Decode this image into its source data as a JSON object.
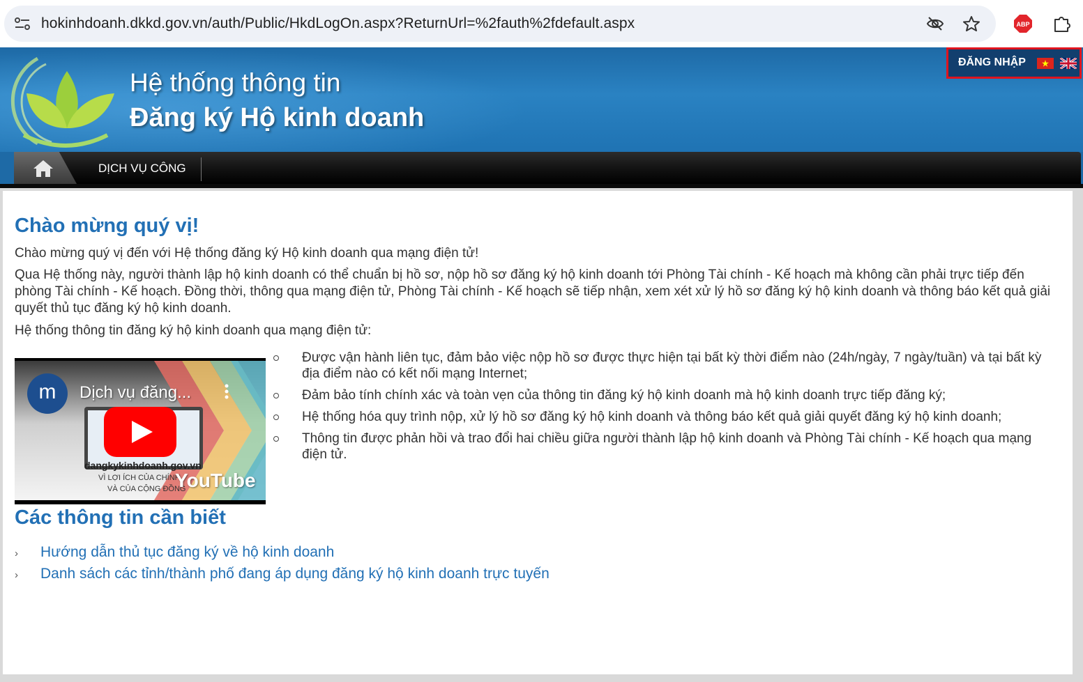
{
  "browser": {
    "url": "hokinhdoanh.dkkd.gov.vn/auth/Public/HkdLogOn.aspx?ReturnUrl=%2fauth%2fdefault.aspx",
    "abp_label": "ABP"
  },
  "header": {
    "title_line1": "Hệ thống thông tin",
    "title_line2": "Đăng ký Hộ kinh doanh",
    "login_label": "ĐĂNG NHẬP"
  },
  "nav": {
    "items": [
      {
        "label": "DỊCH VỤ CÔNG"
      }
    ]
  },
  "main": {
    "welcome_heading": "Chào mừng quý vị!",
    "intro": "Chào mừng quý vị đến với Hệ thống đăng ký Hộ kinh doanh qua mạng điện tử!",
    "description": "Qua Hệ thống này, người thành lập hộ kinh doanh có thể chuẩn bị hồ sơ, nộp hồ sơ đăng ký hộ kinh doanh tới Phòng Tài chính - Kế hoạch mà không cần phải trực tiếp đến phòng Tài chính - Kế hoạch. Đồng thời, thông qua mạng điện tử, Phòng Tài chính - Kế hoạch sẽ tiếp nhận, xem xét xử lý hồ sơ đăng ký hộ kinh doanh và thông báo kết quả giải quyết thủ tục đăng ký hộ kinh doanh.",
    "system_intro": "Hệ thống thông tin đăng ký hộ kinh doanh qua mạng điện tử:",
    "bullets": [
      "Được vận hành liên tục, đảm bảo việc nộp hồ sơ được thực hiện tại bất kỳ thời điểm nào (24h/ngày, 7 ngày/tuần) và tại bất kỳ địa điểm nào có kết nối mạng Internet;",
      "Đảm bảo tính chính xác và toàn vẹn của thông tin đăng ký hộ kinh doanh mà hộ kinh doanh trực tiếp đăng ký;",
      "Hệ thống hóa quy trình nộp, xử lý hồ sơ đăng ký hộ kinh doanh và thông báo kết quả giải quyết đăng ký hộ kinh doanh;",
      "Thông tin được phản hồi và trao đổi hai chiều giữa người thành lập hộ kinh doanh và Phòng Tài chính - Kế hoạch qua mạng điện tử."
    ],
    "video": {
      "channel_initial": "m",
      "title": "Dịch vụ đăng...",
      "caption": "dangkykinhdoanh.gov.vn",
      "sub1": "VÌ LỢI ÍCH CỦA CHÍNH",
      "sub2": "VÀ CỦA CỘNG ĐỒNG",
      "youtube_label": "YouTube"
    },
    "info_heading": "Các thông tin cần biết",
    "links": [
      {
        "arrow": "›",
        "label": "Hướng dẫn thủ tục đăng ký về hộ kinh doanh"
      },
      {
        "arrow": "›",
        "label": "Danh sách các tỉnh/thành phố đang áp dụng đăng ký hộ kinh doanh trực tuyến"
      }
    ]
  },
  "colors": {
    "accent": "#2270b5",
    "header_blue": "#1e6aa6",
    "login_border": "#e0141e"
  }
}
